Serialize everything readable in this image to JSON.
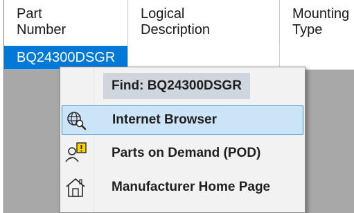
{
  "grid": {
    "columns": [
      {
        "line1": "Part",
        "line2": "Number"
      },
      {
        "line1": "Logical",
        "line2": "Description"
      },
      {
        "line1": "Mounting",
        "line2": "Type"
      }
    ],
    "rows": [
      {
        "part_number": "BQ24300DSGR",
        "logical_description": "",
        "mounting_type": ""
      }
    ],
    "selection_color": "#0078d7"
  },
  "context_menu": {
    "title": "Find: BQ24300DSGR",
    "items": [
      {
        "label": "Internet Browser",
        "icon": "globe-search-icon",
        "highlighted": true
      },
      {
        "label": "Parts on Demand (POD)",
        "icon": "person-warning-icon",
        "highlighted": false
      },
      {
        "label": "Manufacturer Home Page",
        "icon": "home-icon",
        "highlighted": false
      }
    ],
    "highlight_color": "#cce4f7",
    "highlight_border": "#3f8fd2"
  }
}
